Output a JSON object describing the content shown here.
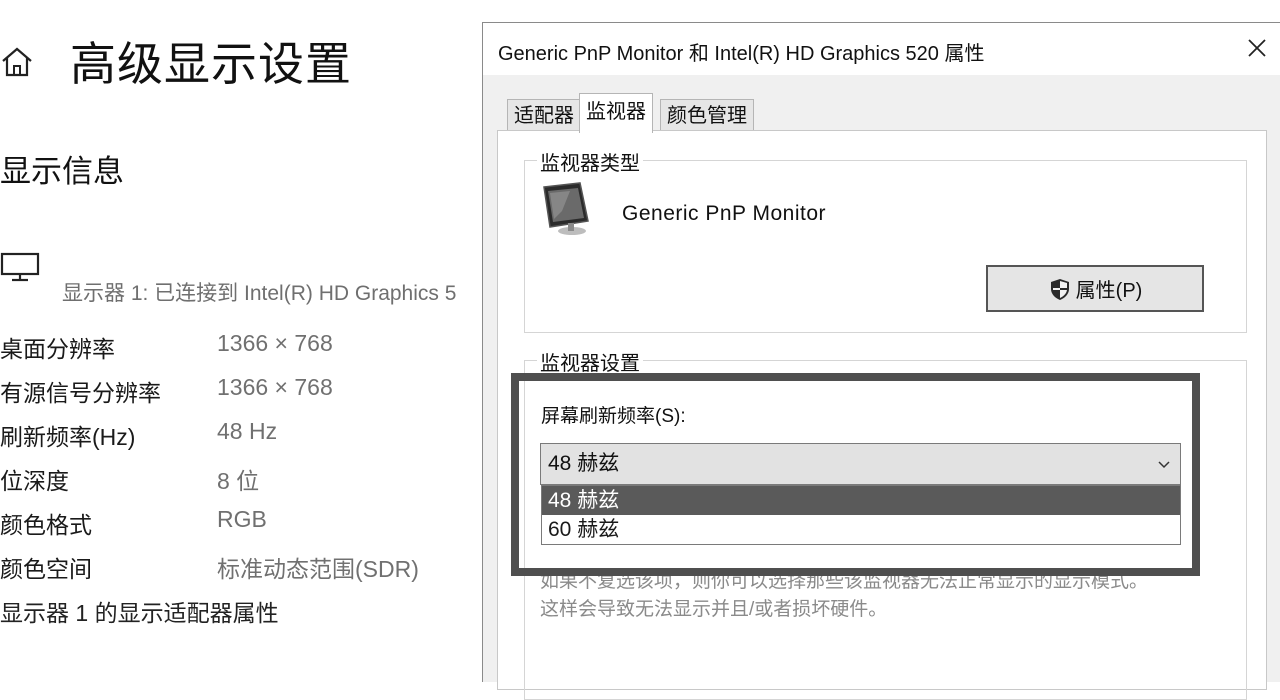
{
  "settings": {
    "page_title": "高级显示设置",
    "section_title": "显示信息",
    "display_connection": "显示器 1: 已连接到 Intel(R) HD Graphics 5",
    "rows": [
      {
        "label": "桌面分辨率",
        "value": "1366 × 768"
      },
      {
        "label": "有源信号分辨率",
        "value": "1366 × 768"
      },
      {
        "label": "刷新频率(Hz)",
        "value": "48 Hz"
      },
      {
        "label": "位深度",
        "value": "8 位"
      },
      {
        "label": "颜色格式",
        "value": "RGB"
      },
      {
        "label": "颜色空间",
        "value": "标准动态范围(SDR)"
      }
    ],
    "adapter_link": "显示器 1 的显示适配器属性",
    "icons": {
      "home": "home-icon",
      "monitor": "monitor-icon"
    }
  },
  "dialog": {
    "title": "Generic PnP Monitor 和 Intel(R) HD Graphics 520 属性",
    "tabs": [
      {
        "label": "适配器",
        "active": false
      },
      {
        "label": "监视器",
        "active": true
      },
      {
        "label": "颜色管理",
        "active": false
      }
    ],
    "monitor_type": {
      "group_label": "监视器类型",
      "monitor_name": "Generic PnP Monitor",
      "properties_button": "属性(P)"
    },
    "monitor_settings": {
      "group_label": "监视器设置",
      "refresh_label": "屏幕刷新频率(S):",
      "selected_value": "48 赫兹",
      "options": [
        "48 赫兹",
        "60 赫兹"
      ],
      "highlighted_option": "48 赫兹",
      "warning_line1": "如果不复选该项，则你可以选择那些该监视器无法正常显示的显示模式。",
      "warning_line2": "这样会导致无法显示并且/或者损坏硬件。"
    }
  },
  "colors": {
    "highlight_frame": "#4f4f4f",
    "selected_option_bg": "#5a5a5a",
    "dialog_bg": "#f0f0f0"
  }
}
